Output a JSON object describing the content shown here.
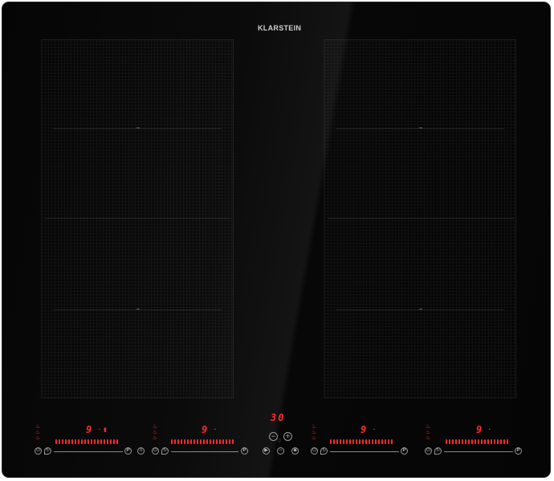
{
  "brand": "KLARSTEIN",
  "timer_display": "30",
  "zones": [
    {
      "name": "left",
      "level": "9",
      "has_timer": true,
      "has_extra": true
    },
    {
      "name": "left2",
      "level": "9",
      "has_timer": true
    },
    {
      "name": "right",
      "level": "9",
      "has_timer": true
    },
    {
      "name": "right2",
      "level": "9",
      "has_timer": true
    }
  ],
  "controls": {
    "p_label": "P",
    "minus": "−",
    "plus": "+"
  },
  "colors": {
    "accent": "#ff2a2a",
    "glass": "#050505"
  }
}
